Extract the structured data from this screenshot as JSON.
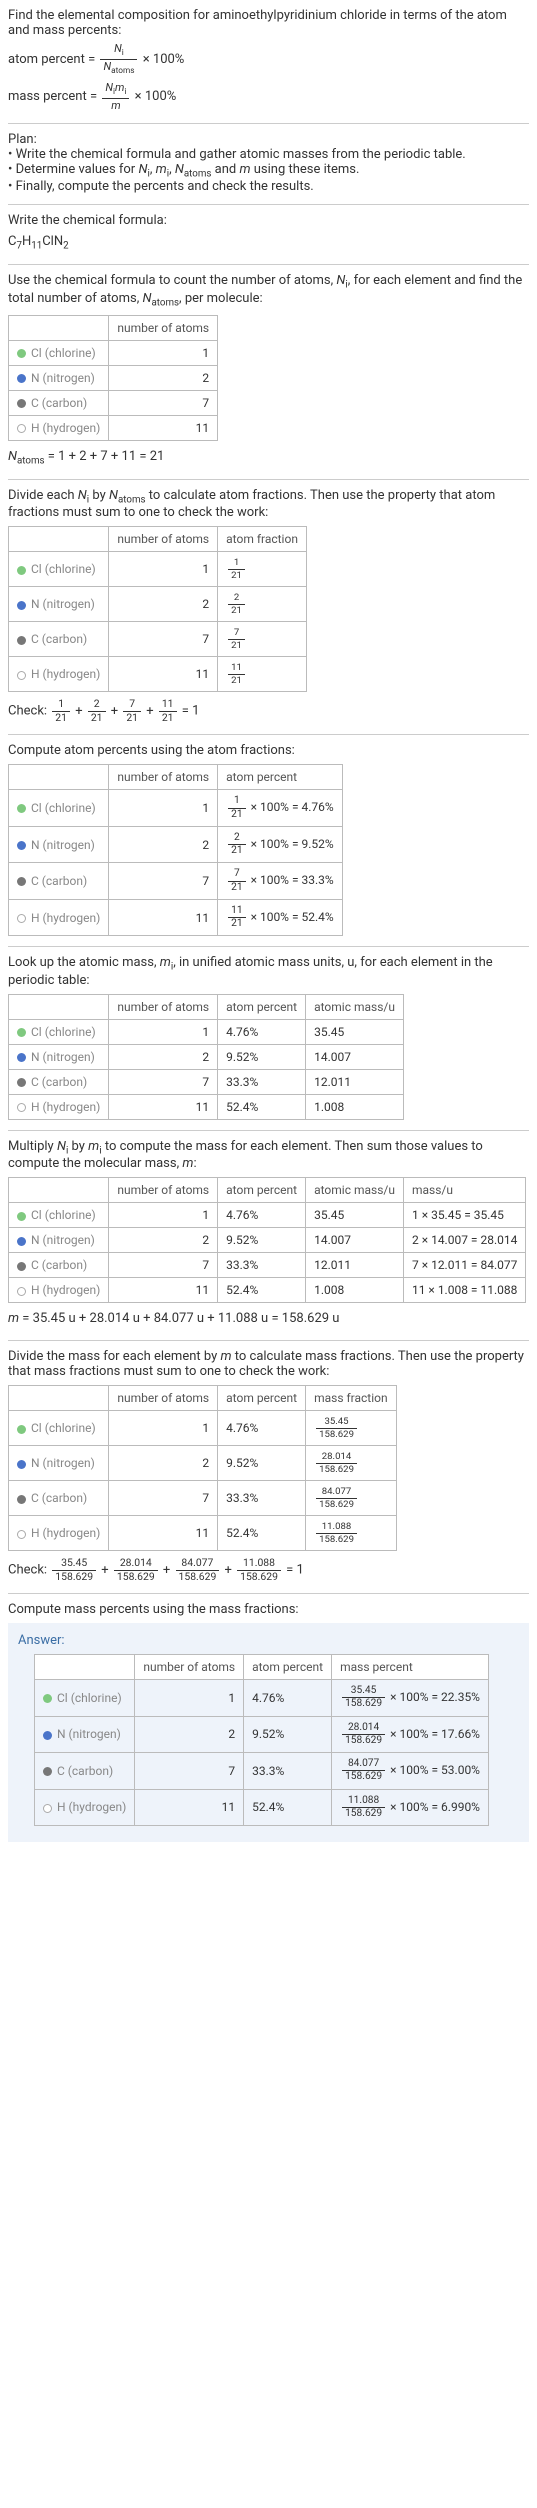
{
  "intro": {
    "line1": "Find the elemental composition for aminoethylpyridinium chloride in terms of the atom and mass percents:",
    "atom_percent_label": "atom percent",
    "mass_percent_label": "mass percent",
    "eq": "=",
    "times100": "× 100%",
    "Ni": "N",
    "Ni_sub": "i",
    "Natoms": "N",
    "Natoms_sub": "atoms",
    "mi": "m",
    "mi_sub": "i",
    "m": "m"
  },
  "plan": {
    "heading": "Plan:",
    "b1": "• Write the chemical formula and gather atomic masses from the periodic table.",
    "b2pre": "• Determine values for ",
    "b2mid1": ", ",
    "b2mid2": ", ",
    "b2mid3": " and ",
    "b2post": " using these items.",
    "b3": "• Finally, compute the percents and check the results."
  },
  "formula_section": {
    "heading": "Write the chemical formula:",
    "C": "C",
    "C_n": "7",
    "H": "H",
    "H_n": "11",
    "Cl": "Cl",
    "N": "N",
    "N_n": "2"
  },
  "count_section": {
    "text_a": "Use the chemical formula to count the number of atoms, ",
    "text_b": ", for each element and find the total number of atoms, ",
    "text_c": ", per molecule:",
    "header_count": "number of atoms",
    "sum_prefix": " = 1 + 2 + 7 + 11 = 21"
  },
  "elements": [
    {
      "name": "Cl (chlorine)",
      "atoms": "1",
      "frac_num": "1",
      "frac_den": "21",
      "pct": "4.76%",
      "mass": "35.45",
      "mass_expr": "1 × 35.45 = 35.45",
      "mfrac_num": "35.45",
      "mfrac_den": "158.629",
      "mpct": "22.35%",
      "dot_style": "background:#7fc97f;"
    },
    {
      "name": "N (nitrogen)",
      "atoms": "2",
      "frac_num": "2",
      "frac_den": "21",
      "pct": "9.52%",
      "mass": "14.007",
      "mass_expr": "2 × 14.007 = 28.014",
      "mfrac_num": "28.014",
      "mfrac_den": "158.629",
      "mpct": "17.66%",
      "dot_style": "background:#4a74c9;"
    },
    {
      "name": "C (carbon)",
      "atoms": "7",
      "frac_num": "7",
      "frac_den": "21",
      "pct": "33.3%",
      "mass": "12.011",
      "mass_expr": "7 × 12.011 = 84.077",
      "mfrac_num": "84.077",
      "mfrac_den": "158.629",
      "mpct": "53.00%",
      "dot_style": "background:#777;"
    },
    {
      "name": "H (hydrogen)",
      "atoms": "11",
      "frac_num": "11",
      "frac_den": "21",
      "pct": "52.4%",
      "mass": "1.008",
      "mass_expr": "11 × 1.008 = 11.088",
      "mfrac_num": "11.088",
      "mfrac_den": "158.629",
      "mpct": "6.990%",
      "dot_style": "background:#fff;border:1px solid #aaa;"
    }
  ],
  "atomfrac_section": {
    "text_a": "Divide each ",
    "text_b": " by ",
    "text_c": " to calculate atom fractions. Then use the property that atom fractions must sum to one to check the work:",
    "header_frac": "atom fraction",
    "check_label": "Check: ",
    "check_eq": " = 1",
    "plus": " + "
  },
  "atompct_section": {
    "text": "Compute atom percents using the atom fractions:",
    "header_pct": "atom percent",
    "times100eq": " × 100% = "
  },
  "mass_section": {
    "text_a": "Look up the atomic mass, ",
    "text_b": ", in unified atomic mass units, u, for each element in the periodic table:",
    "header_mass": "atomic mass/u"
  },
  "massmul_section": {
    "text_a": "Multiply ",
    "text_b": " by ",
    "text_c": " to compute the mass for each element. Then sum those values to compute the molecular mass, ",
    "text_d": ":",
    "header_massu": "mass/u",
    "sum": " = 35.45 u + 28.014 u + 84.077 u + 11.088 u = 158.629 u"
  },
  "massfrac_section": {
    "text_a": "Divide the mass for each element by ",
    "text_b": " to calculate mass fractions. Then use the property that mass fractions must sum to one to check the work:",
    "header_mfrac": "mass fraction",
    "check_label": "Check: ",
    "check_eq": " = 1",
    "plus": " + "
  },
  "masspct_section": {
    "text": "Compute mass percents using the mass fractions:",
    "answer_label": "Answer:",
    "header_mpct": "mass percent",
    "times100eq": " × 100% = "
  }
}
